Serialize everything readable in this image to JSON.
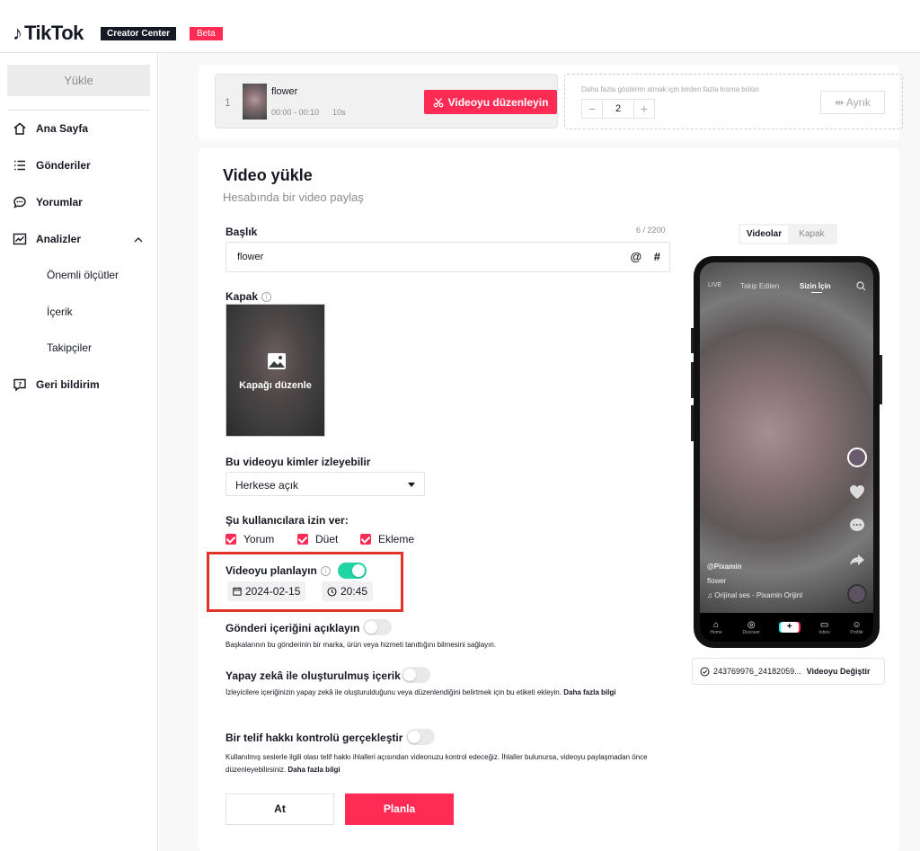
{
  "app": {
    "logo_text": "TikTok",
    "creator_center": "Creator Center",
    "beta": "Beta"
  },
  "sidebar": {
    "upload": "Yükle",
    "items": [
      {
        "label": "Ana Sayfa",
        "icon": "home-icon"
      },
      {
        "label": "Gönderiler",
        "icon": "list-icon"
      },
      {
        "label": "Yorumlar",
        "icon": "comment-icon"
      },
      {
        "label": "Analizler",
        "icon": "chart-icon"
      },
      {
        "label": "Geri bildirim",
        "icon": "feedback-icon"
      }
    ],
    "analytics_sub": [
      "Önemli ölçütler",
      "İçerik",
      "Takipçiler"
    ]
  },
  "file": {
    "index": "1",
    "name": "flower",
    "range": "00:00 - 00:10",
    "duration": "10s",
    "edit_button": "Videoyu düzenleyin",
    "split_hint": "Daha fazla gösterim almak için birden fazla kısma bölün",
    "split_count": "2",
    "minus": "−",
    "plus": "+",
    "separate_button": "Ayrık"
  },
  "form": {
    "title": "Video yükle",
    "subtitle": "Hesabında bir video paylaş",
    "caption_label": "Başlık",
    "caption_count": "6 / 2200",
    "caption_value": "flower",
    "mention": "@",
    "hashtag": "#",
    "cover_label": "Kapak",
    "cover_edit": "Kapağı düzenle",
    "privacy_label": "Bu videoyu kimler izleyebilir",
    "privacy_value": "Herkese açık",
    "allow_label": "Şu kullanıcılara izin ver:",
    "allow_options": [
      "Yorum",
      "Düet",
      "Ekleme"
    ],
    "schedule_label": "Videoyu planlayın",
    "schedule_on": true,
    "schedule_date": "2024-02-15",
    "schedule_time": "20:45",
    "disclose_label": "Gönderi içeriğini açıklayın",
    "disclose_desc": "Başkalarının bu gönderinin bir marka, ürün veya hizmeti tanıttığını bilmesini sağlayın.",
    "ai_label": "Yapay zekâ ile oluşturulmuş içerik",
    "ai_desc": "İzleyicilere içeriğinizin yapay zekâ ile oluşturulduğunu veya düzenlendiğini belirtmek için bu etiketi ekleyin.",
    "ai_more": "Daha fazla bilgi",
    "copyright_label": "Bir telif hakkı kontrolü gerçekleştir",
    "copyright_desc": "Kullanılmış seslerle ilgili olası telif hakkı ihlalleri açısından videonuzu kontrol edeceğiz. İhlaller bulunursa, videoyu paylaşmadan önce düzenleyebilirsiniz.",
    "copyright_more": "Daha fazla bilgi",
    "discard_button": "At",
    "schedule_button": "Planla"
  },
  "preview": {
    "tabs": [
      "Videolar",
      "Kapak"
    ],
    "live": "LIVE",
    "following": "Takip Edilen",
    "for_you": "Sizin İçin",
    "username": "@Pixamin",
    "description": "flower",
    "sound": "Orijinal ses - Pixamin Orijinl",
    "nav": [
      "Home",
      "Discover",
      "Inbox",
      "Profile"
    ],
    "file_id": "243769976_24182059...",
    "change_video": "Videoyu Değiştir"
  },
  "colors": {
    "accent": "#fe2c55",
    "toggle_on": "#20d5a3",
    "highlight": "#e0332a"
  }
}
